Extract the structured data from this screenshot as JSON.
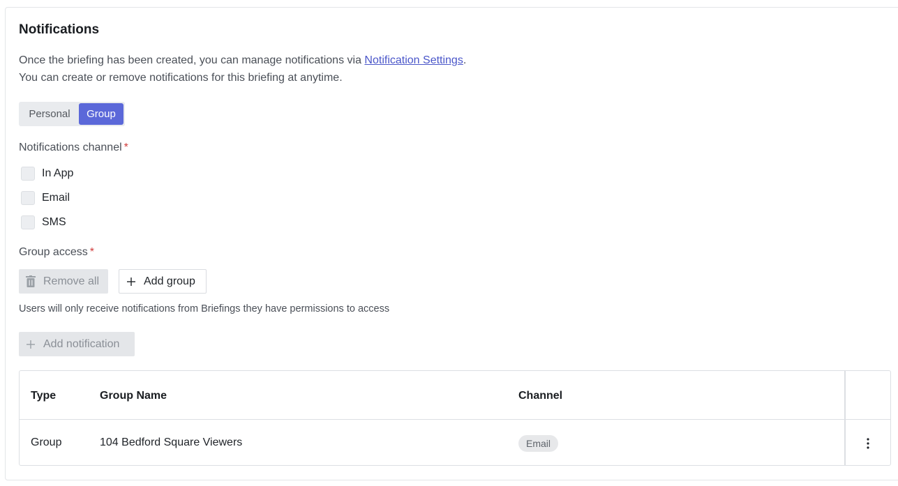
{
  "section": {
    "title": "Notifications",
    "desc_prefix": "Once the briefing has been created, you can manage notifications via ",
    "desc_link": "Notification Settings",
    "desc_suffix": ".",
    "desc_line2": "You can create or remove notifications for this briefing at anytime."
  },
  "toggle": {
    "options": [
      "Personal",
      "Group"
    ],
    "selected": "Group"
  },
  "channel": {
    "label": "Notifications channel",
    "required_mark": "*",
    "options": [
      {
        "label": "In App",
        "checked": false
      },
      {
        "label": "Email",
        "checked": false
      },
      {
        "label": "SMS",
        "checked": false
      }
    ]
  },
  "group_access": {
    "label": "Group access",
    "required_mark": "*",
    "remove_all_label": "Remove all",
    "add_group_label": "Add group",
    "hint": "Users will only receive notifications from Briefings they have permissions to access"
  },
  "add_notification_label": "Add notification",
  "table": {
    "headers": {
      "type": "Type",
      "group_name": "Group Name",
      "channel": "Channel"
    },
    "rows": [
      {
        "type": "Group",
        "group_name": "104 Bedford Square Viewers",
        "channel": "Email"
      }
    ]
  },
  "colors": {
    "accent": "#5b68d9",
    "link": "#4a56c9",
    "required": "#d03b3b"
  },
  "icons": {
    "remove_all": "trash-icon",
    "add_group": "plus-icon",
    "add_notification": "plus-icon",
    "row_menu": "more-vertical-icon"
  }
}
